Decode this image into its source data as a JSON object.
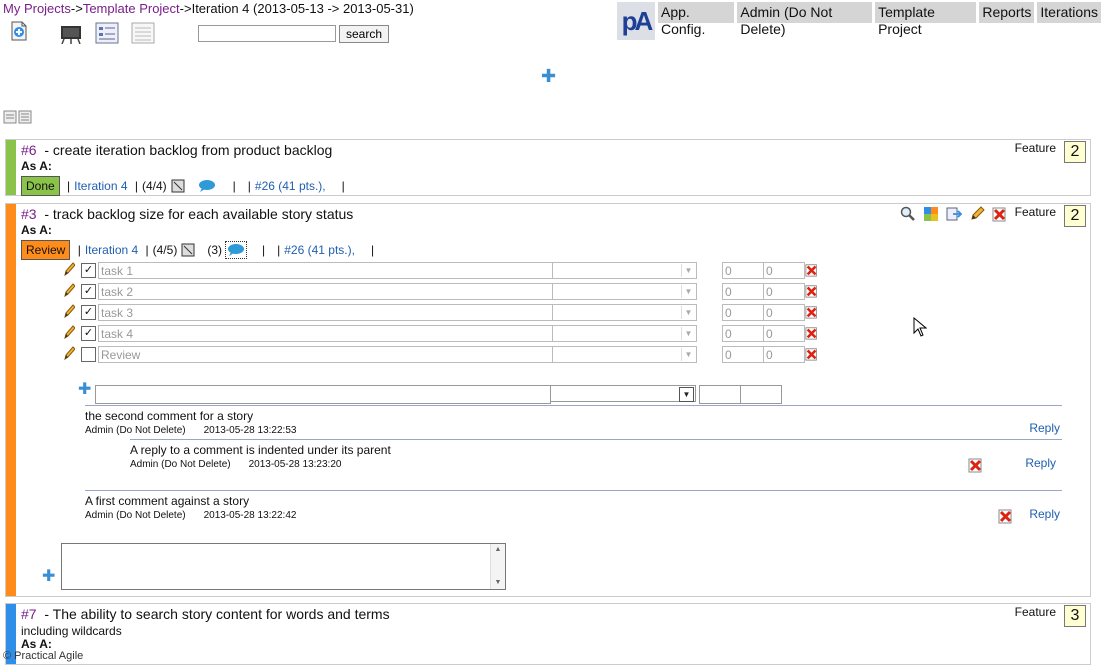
{
  "breadcrumb": {
    "my_projects": "My Projects",
    "sep": "->",
    "project": "Template Project",
    "iteration": "Iteration 4 (2013-05-13 -> 2013-05-31)"
  },
  "search": {
    "value": "",
    "button_label": "search"
  },
  "logo_text": "pA",
  "nav": [
    "App. Config.",
    "Admin (Do Not Delete)",
    "Template Project",
    "Reports",
    "Iterations"
  ],
  "stories": [
    {
      "id": "#6",
      "title": "- create iteration backlog from product backlog",
      "as_a": "As A:",
      "type": "Feature",
      "points": "2",
      "status": "Done",
      "status_color": "#8bc34a",
      "stripe_color": "#8bc34a",
      "iteration": "Iteration 4",
      "tasks_done": "(4/4)",
      "release": "#26 (41 pts.),"
    },
    {
      "id": "#3",
      "title": "- track backlog size for each available story status",
      "as_a": "As A:",
      "type": "Feature",
      "points": "2",
      "status": "Review",
      "status_color": "#ff8c1a",
      "stripe_color": "#ff8c1a",
      "iteration": "Iteration 4",
      "tasks_done": "(4/5)",
      "comment_count": "(3)",
      "release": "#26 (41 pts.),",
      "tasks": [
        {
          "name": "task 1",
          "checked": true,
          "estimate": "0",
          "remaining": "0"
        },
        {
          "name": "task 2",
          "checked": true,
          "estimate": "0",
          "remaining": "0"
        },
        {
          "name": "task 3",
          "checked": true,
          "estimate": "0",
          "remaining": "0"
        },
        {
          "name": "task 4",
          "checked": true,
          "estimate": "0",
          "remaining": "0"
        },
        {
          "name": "Review",
          "checked": false,
          "estimate": "0",
          "remaining": "0"
        }
      ],
      "comments": [
        {
          "text": "the second comment for a story",
          "author": "Admin (Do Not Delete)",
          "date": "2013-05-28 13:22:53",
          "reply": "Reply"
        },
        {
          "text": "A reply to a comment is indented under its parent",
          "author": "Admin (Do Not Delete)",
          "date": "2013-05-28 13:23:20",
          "reply": "Reply"
        },
        {
          "text": "A first comment against a story",
          "author": "Admin (Do Not Delete)",
          "date": "2013-05-28 13:22:42",
          "reply": "Reply"
        }
      ]
    },
    {
      "id": "#7",
      "title": "- The ability to search story content for words and terms",
      "subtitle": "including wildcards",
      "as_a": "As A:",
      "type": "Feature",
      "points": "3",
      "stripe_color": "#2f8ee8"
    }
  ],
  "footer_text": "© Practical Agile",
  "colors": {
    "link": "#1f5fb0",
    "breadcrumb": "#7a1f8a",
    "add_plus": "#3a8fd4"
  }
}
